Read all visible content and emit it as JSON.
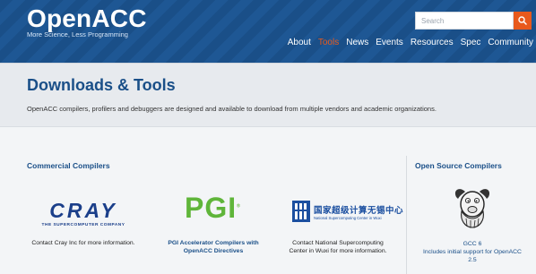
{
  "header": {
    "logo_title": "OpenACC",
    "logo_tagline": "More Science, Less Programming",
    "search_placeholder": "Search",
    "nav": [
      {
        "label": "About",
        "active": false
      },
      {
        "label": "Tools",
        "active": true
      },
      {
        "label": "News",
        "active": false
      },
      {
        "label": "Events",
        "active": false
      },
      {
        "label": "Resources",
        "active": false
      },
      {
        "label": "Spec",
        "active": false
      },
      {
        "label": "Community",
        "active": false
      }
    ]
  },
  "titleband": {
    "title": "Downloads & Tools",
    "description": "OpenACC compilers, profilers and debuggers are designed and available to download from multiple vendors and academic organizations."
  },
  "commercial": {
    "heading": "Commercial Compilers",
    "cray": {
      "logo_word": "CRAY",
      "logo_sub": "THE SUPERCOMPUTER COMPANY",
      "text": "Contact Cray Inc for more information."
    },
    "pgi": {
      "logo_word": "PGI",
      "logo_mark": "®",
      "link_line1": "PGI Accelerator Compilers with",
      "link_line2": "OpenACC Directives"
    },
    "wuxi": {
      "logo_cn": "国家超级计算无锡中心",
      "logo_en": "National Supercomputing Center in Wuxi",
      "text_line1": "Contact National Supercomputing",
      "text_line2": "Center in Wuxi for more information."
    }
  },
  "opensource": {
    "heading": "Open Source Compilers",
    "gcc": {
      "title": "GCC 6",
      "text_line1": "Includes initial support for OpenACC",
      "text_line2": "2.5"
    }
  },
  "colors": {
    "brand_blue": "#1a4f88",
    "accent_orange": "#e8591c",
    "pgi_green": "#5fb53a"
  },
  "icons": {
    "search": "search-icon",
    "gnu": "gnu-logo-icon",
    "wuxi": "wuxi-emblem-icon"
  }
}
